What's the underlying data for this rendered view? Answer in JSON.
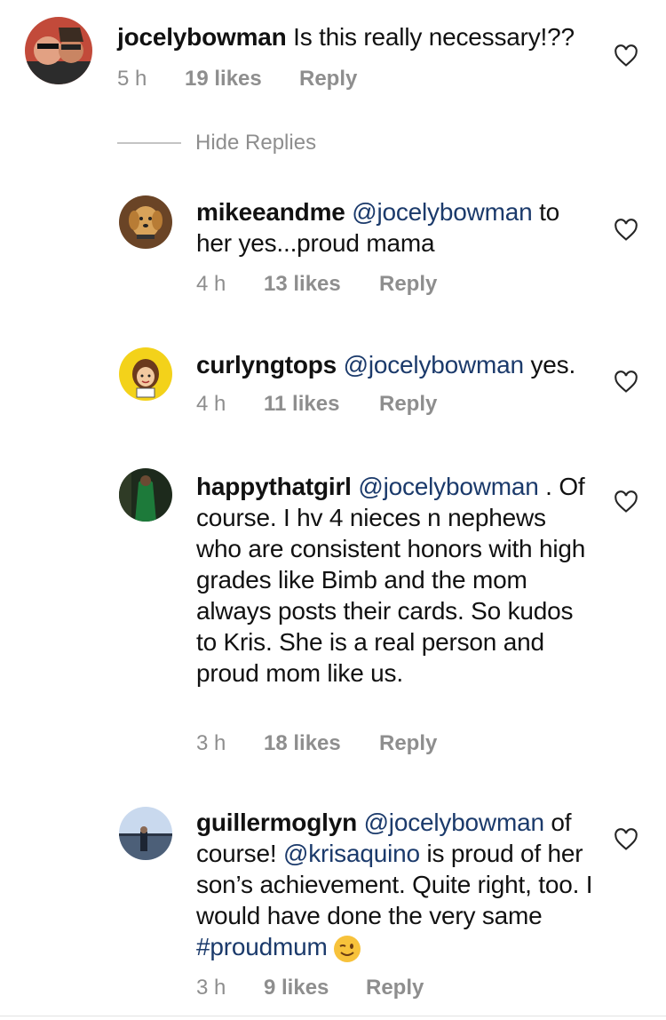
{
  "comments": [
    {
      "username": "jocelybowman",
      "text_pre": " Is this really necessary!??",
      "mention": "",
      "text_post": "",
      "time": "5 h",
      "likes": "19 likes",
      "reply": "Reply"
    },
    {
      "username": "mikeeandme",
      "mention": "@jocelybowman",
      "text_post": " to her yes...proud mama",
      "time": "4 h",
      "likes": "13 likes",
      "reply": "Reply"
    },
    {
      "username": "curlyngtops",
      "mention": "@jocelybowman",
      "text_post": " yes.",
      "time": "4 h",
      "likes": "11 likes",
      "reply": "Reply"
    },
    {
      "username": "happythatgirl",
      "mention": "@jocelybowman",
      "text_post": " . Of course. I hv 4 nieces n nephews who are consistent honors with high grades like Bimb and the mom always posts their cards. So kudos to Kris. She is a real person and proud mom like us.",
      "time": "3 h",
      "likes": "18 likes",
      "reply": "Reply"
    },
    {
      "username": "guillermoglyn",
      "mention": "@jocelybowman",
      "text_mid": " of course! ",
      "mention2": "@krisaquino",
      "text_post": " is proud of her son’s achievement. Quite right, too. I would have done the very same  ",
      "hashtag": "#proudmum",
      "time": "3 h",
      "likes": "9 likes",
      "reply": "Reply"
    }
  ],
  "hide_replies": "Hide Replies",
  "icons": {
    "like": "heart-outline-icon",
    "emoji": "winking-face-emoji"
  },
  "colors": {
    "mention": "#1b3a6b",
    "meta": "#8e8e8e"
  }
}
